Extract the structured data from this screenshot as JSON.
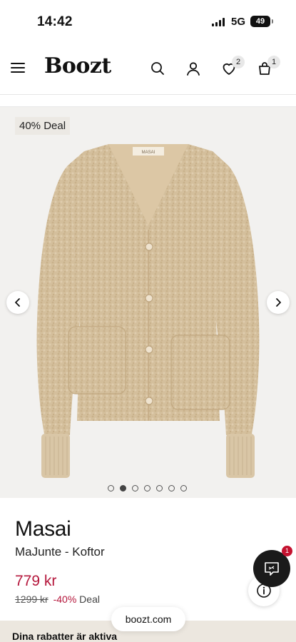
{
  "status": {
    "time": "14:42",
    "network": "5G",
    "battery": "49"
  },
  "header": {
    "logo": "Boozt",
    "wishlist_count": "2",
    "cart_count": "1"
  },
  "gallery": {
    "deal_badge": "40% Deal",
    "label_text": "MASAI",
    "slide_count": 7,
    "active_slide": 2
  },
  "product": {
    "brand": "Masai",
    "name": "MaJunte - Koftor",
    "price": "779 kr",
    "original_price": "1299 kr",
    "discount": "-40%",
    "deal_label": "Deal"
  },
  "chat": {
    "badge": "1"
  },
  "browser": {
    "url": "boozt.com"
  },
  "bottom_bar": {
    "text": "Dina rabatter är aktiva"
  },
  "colors": {
    "sale": "#b5173c",
    "chat_bg": "#1a1a1a",
    "product": "#d4bf9c"
  }
}
